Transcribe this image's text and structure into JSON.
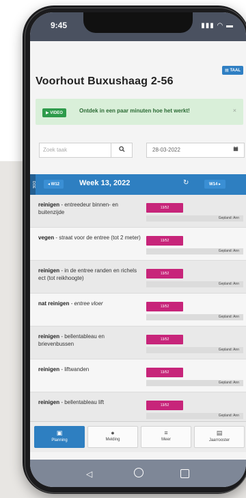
{
  "status": {
    "time": "9:45",
    "icons": "▮▮▮ ◠ ▬"
  },
  "lang_button": "▤ TAAL",
  "page_title": "Voorhout Buxushaag 2-56",
  "notice": {
    "video_label": "▶ VIDEO",
    "text": "Ontdek in een paar minuten hoe het werkt!",
    "close": "×"
  },
  "search": {
    "placeholder": "Zoek taak",
    "icon": "search-icon"
  },
  "date_field": {
    "value": "28-03-2022",
    "icon": "calendar-icon"
  },
  "week_nav": {
    "side_tag": "DOE",
    "prev_label": "◂ W12",
    "week_label": "Week 13, 2022",
    "refresh": "↻",
    "next_label": "W14 ▸"
  },
  "tasks": [
    {
      "bold": "reinigen",
      "rest": " - entreedeur binnen- en buitenzijde",
      "badge": "13/52",
      "planned": "Gepland: Ann"
    },
    {
      "bold": "vegen",
      "rest": " - straat voor de entree (tot 2 meter)",
      "badge": "13/52",
      "planned": "Gepland: Ann"
    },
    {
      "bold": "reinigen",
      "rest": " - in de entree randen en richels ect (tot reikhoogte)",
      "badge": "13/52",
      "planned": "Gepland: Ann"
    },
    {
      "bold": "nat reinigen",
      "rest": " - entree vloer",
      "badge": "13/52",
      "planned": "Gepland: Ann"
    },
    {
      "bold": "reinigen",
      "rest": " - bellentableau en brievenbussen",
      "badge": "13/52",
      "planned": "Gepland: Ann"
    },
    {
      "bold": "reinigen",
      "rest": " - liftwanden",
      "badge": "13/52",
      "planned": "Gepland: Ann"
    },
    {
      "bold": "reinigen",
      "rest": " - bellentableau lift",
      "badge": "13/52",
      "planned": "Gepland: Ann"
    }
  ],
  "tabs": [
    {
      "label": "Planning",
      "icon": "▣"
    },
    {
      "label": "Melding",
      "icon": "●"
    },
    {
      "label": "Meer",
      "icon": "≡"
    },
    {
      "label": "Jaarrooster",
      "icon": "▤"
    }
  ],
  "system_nav": {
    "back": "◁"
  },
  "colors": {
    "primary": "#2e7fc1",
    "badge": "#c7257a",
    "notice_bg": "#d9efd9",
    "video_btn": "#2e9b4b"
  }
}
